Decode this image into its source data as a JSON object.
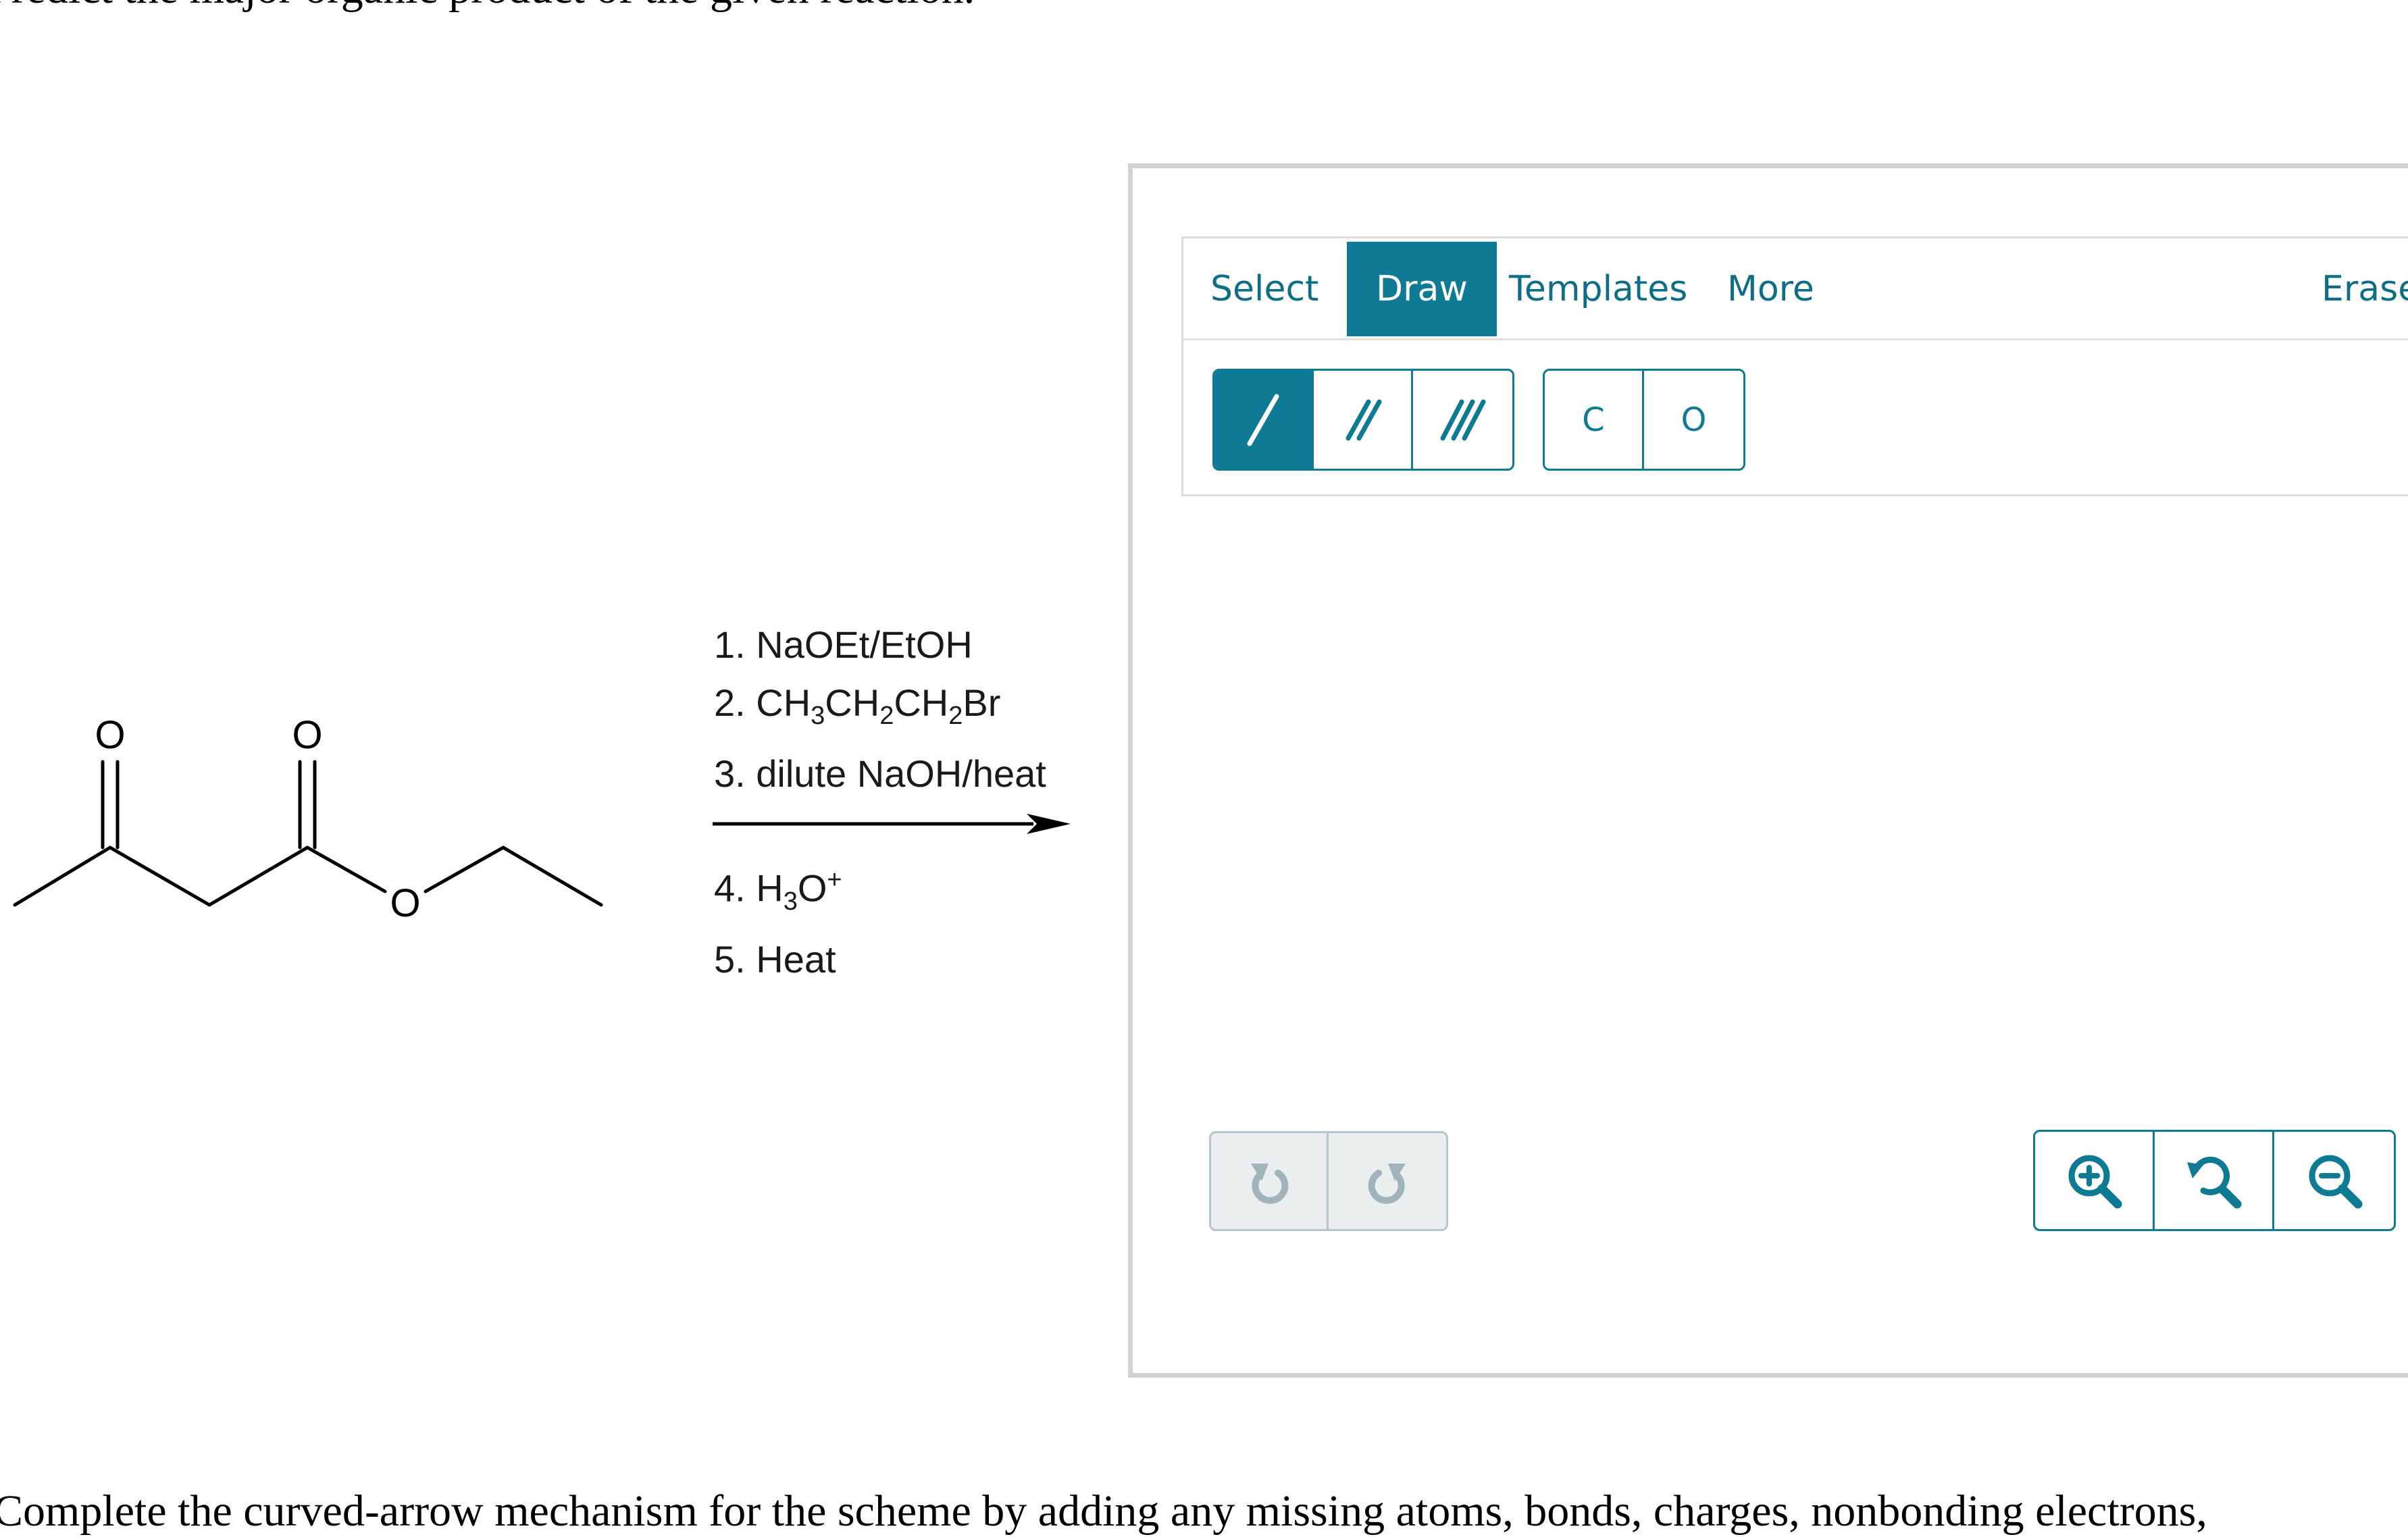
{
  "question": {
    "top_text": "Predict the major organic product of the given reaction.",
    "bottom_text": "Complete the curved-arrow mechanism for the scheme by adding any missing atoms, bonds, charges, nonbonding electrons,"
  },
  "reactant": {
    "atom_labels": [
      "O",
      "O",
      "O"
    ]
  },
  "conditions": {
    "step1": "1. NaOEt/EtOH",
    "step2_prefix": "2. CH",
    "step2_sub1": "3",
    "step2_mid1": "CH",
    "step2_sub2": "2",
    "step2_mid2": "CH",
    "step2_sub3": "2",
    "step2_suffix": "Br",
    "step3": "3. dilute NaOH/heat",
    "step4_prefix": "4. H",
    "step4_sub": "3",
    "step4_mid": "O",
    "step4_sup": "+",
    "step5": "5. Heat"
  },
  "sketcher": {
    "tabs": {
      "select": "Select",
      "draw": "Draw",
      "templates": "Templates",
      "more": "More",
      "erase": "Erase"
    },
    "active_tab": "Draw",
    "atoms": [
      "C",
      "O"
    ],
    "bond_tools": [
      "single-bond-icon",
      "double-bond-icon",
      "triple-bond-icon"
    ],
    "selected_bond": "single-bond-icon",
    "history_tools": [
      "undo-icon",
      "redo-icon"
    ],
    "zoom_tools": [
      "zoom-in-icon",
      "zoom-reset-icon",
      "zoom-out-icon"
    ]
  },
  "colors": {
    "accent": "#0e7a93",
    "tab_text": "#0e6e85",
    "disabled_bg": "#ebeeef",
    "disabled_icon": "#9fb4bb",
    "frame_border": "#d2d2d2"
  }
}
